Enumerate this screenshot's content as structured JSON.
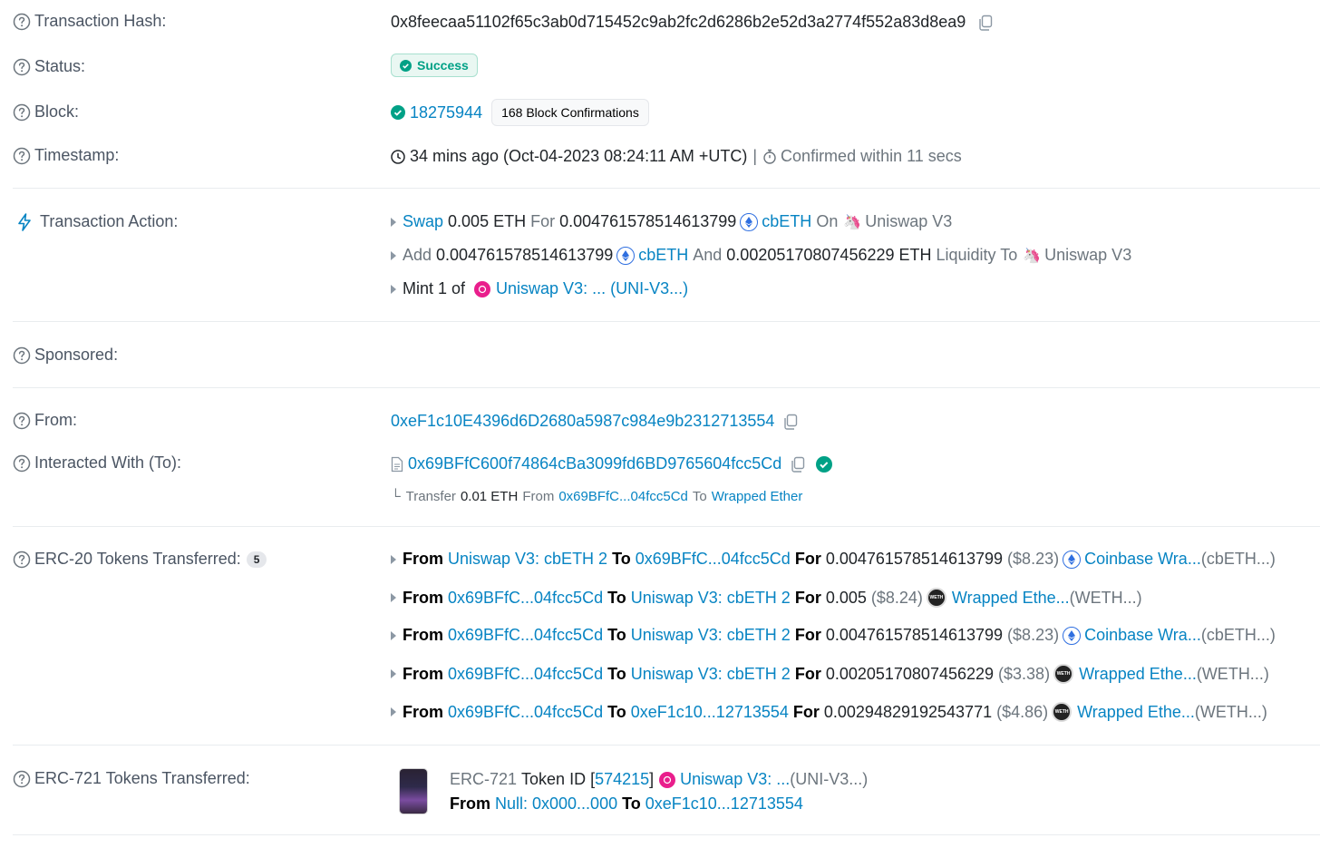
{
  "labels": {
    "tx_hash": "Transaction Hash:",
    "status": "Status:",
    "block": "Block:",
    "timestamp": "Timestamp:",
    "tx_action": "Transaction Action:",
    "sponsored": "Sponsored:",
    "from": "From:",
    "interacted": "Interacted With (To):",
    "erc20": "ERC-20 Tokens Transferred:",
    "erc721": "ERC-721 Tokens Transferred:"
  },
  "tx_hash": "0x8feecaa51102f65c3ab0d715452c9ab2fc2d6286b2e52d3a2774f552a83d8ea9",
  "status": "Success",
  "block": {
    "number": "18275944",
    "confirmations": "168 Block Confirmations"
  },
  "timestamp": {
    "text": "34 mins ago (Oct-04-2023 08:24:11 AM +UTC)",
    "separator": "|",
    "confirmed": "Confirmed within 11 secs"
  },
  "actions": [
    {
      "verb": "Swap",
      "amount": "0.005 ETH",
      "for": "For",
      "amount2": "0.004761578514613799",
      "token": "cbETH",
      "on": "On",
      "dex": "Uniswap V3"
    },
    {
      "verb": "Add",
      "amount": "0.004761578514613799",
      "token": "cbETH",
      "and": "And",
      "amount2": "0.00205170807456229 ETH",
      "liquidity": "Liquidity To",
      "dex": "Uniswap V3"
    },
    {
      "verb": "Mint 1 of",
      "token": "Uniswap V3: ... (UNI-V3...)"
    }
  ],
  "from_address": "0xeF1c10E4396d6D2680a5987c984e9b2312713554",
  "to": {
    "address": "0x69BFfC600f74864cBa3099fd6BD9765604fcc5Cd",
    "transfer_prefix": "Transfer",
    "transfer_amount": "0.01 ETH",
    "transfer_from_word": "From",
    "transfer_from": "0x69BFfC...04fcc5Cd",
    "transfer_to_word": "To",
    "transfer_to": "Wrapped Ether"
  },
  "erc20_count": "5",
  "erc20": [
    {
      "from": "Uniswap V3: cbETH 2",
      "to": "0x69BFfC...04fcc5Cd",
      "amount": "0.004761578514613799",
      "usd": "($8.23)",
      "token": "Coinbase Wra...",
      "symbol": "(cbETH...)",
      "icon": "eth"
    },
    {
      "from": "0x69BFfC...04fcc5Cd",
      "to": "Uniswap V3: cbETH 2",
      "amount": "0.005",
      "usd": "($8.24)",
      "token": "Wrapped Ethe...",
      "symbol": "(WETH...)",
      "icon": "weth"
    },
    {
      "from": "0x69BFfC...04fcc5Cd",
      "to": "Uniswap V3: cbETH 2",
      "amount": "0.004761578514613799",
      "usd": "($8.23)",
      "token": "Coinbase Wra...",
      "symbol": "(cbETH...)",
      "icon": "eth"
    },
    {
      "from": "0x69BFfC...04fcc5Cd",
      "to": "Uniswap V3: cbETH 2",
      "amount": "0.00205170807456229",
      "usd": "($3.38)",
      "token": "Wrapped Ethe...",
      "symbol": "(WETH...)",
      "icon": "weth"
    },
    {
      "from": "0x69BFfC...04fcc5Cd",
      "to": "0xeF1c10...12713554",
      "amount": "0.00294829192543771",
      "usd": "($4.86)",
      "token": "Wrapped Ethe...",
      "symbol": "(WETH...)",
      "icon": "weth"
    }
  ],
  "words": {
    "from": "From",
    "to": "To",
    "for": "For"
  },
  "erc721": {
    "prefix": "ERC-721",
    "token_id_label": "Token ID [",
    "token_id": "574215",
    "close": "]",
    "token": "Uniswap V3: ...",
    "symbol": "(UNI-V3...)",
    "from": "Null: 0x000...000",
    "to": "0xeF1c10...12713554"
  },
  "weth_icon_text": "WETH",
  "colors": {
    "link": "#0784c3",
    "success": "#00a186",
    "muted": "#6c757d"
  }
}
